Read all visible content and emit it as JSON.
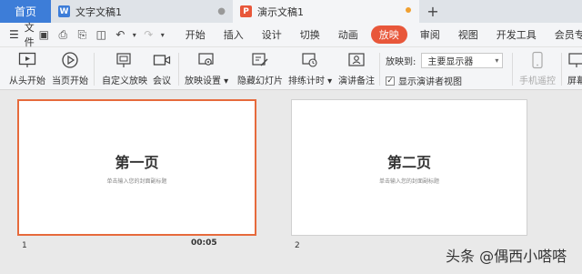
{
  "tabs": {
    "home": "首页",
    "doc": "文字文稿1",
    "ppt": "演示文稿1",
    "add": "+"
  },
  "menubar": {
    "file": "文件",
    "items": [
      "开始",
      "插入",
      "设计",
      "切换",
      "动画",
      "放映",
      "审阅",
      "视图",
      "开发工具",
      "会员专享"
    ],
    "active": "放映"
  },
  "ribbon": {
    "from_start": "从头开始",
    "from_current": "当页开始",
    "custom_show": "自定义放映",
    "meeting": "会议",
    "show_settings": "放映设置",
    "hide_slide": "隐藏幻灯片",
    "rehearse": "排练计时",
    "speaker_notes": "演讲备注",
    "show_to_label": "放映到:",
    "show_to_value": "主要显示器",
    "presenter_view": "显示演讲者视图",
    "phone_remote": "手机遥控",
    "screen": "屏幕"
  },
  "slides": [
    {
      "num": "1",
      "title": "第一页",
      "subtitle": "单击输入您的封面副标题",
      "time": "00:05"
    },
    {
      "num": "2",
      "title": "第二页",
      "subtitle": "单击输入您的封面副标题"
    }
  ],
  "watermark": "头条 @偶西小嗒嗒",
  "colors": {
    "accent": "#e8573a",
    "home_tab": "#3d7dd8",
    "selected_border": "#e66a3c"
  }
}
